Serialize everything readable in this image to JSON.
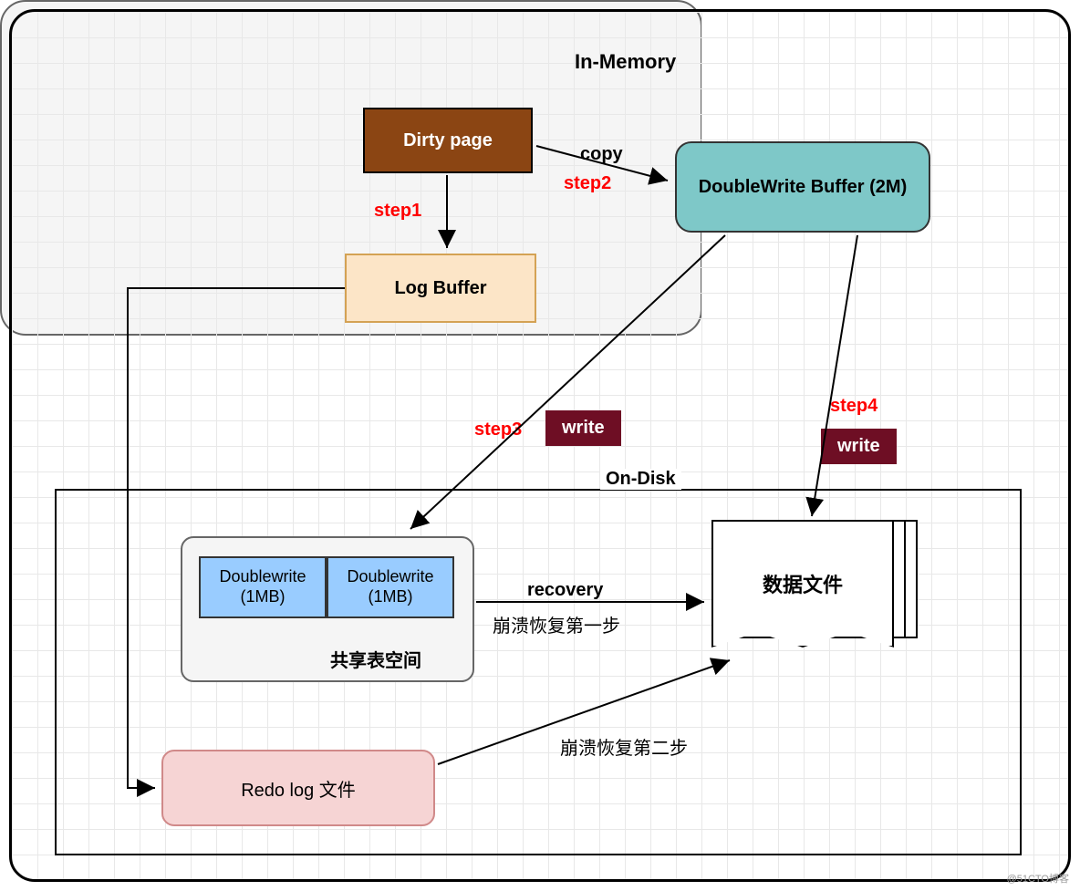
{
  "memory": {
    "title": "In-Memory",
    "dirty_page": "Dirty page",
    "dw_buffer": "DoubleWrite Buffer (2M)",
    "log_buffer": "Log Buffer"
  },
  "steps": {
    "s1": "step1",
    "s2": "step2",
    "s3": "step3",
    "s4": "step4",
    "copy": "copy",
    "write": "write"
  },
  "disk": {
    "title": "On-Disk",
    "dw_cell": "Doublewrite (1MB)",
    "shared_ts": "共享表空间",
    "redolog": "Redo log 文件",
    "datafile": "数据文件",
    "recovery": "recovery",
    "crash1": "崩溃恢复第一步",
    "crash2": "崩溃恢复第二步"
  },
  "watermark": "@51CTO博客"
}
